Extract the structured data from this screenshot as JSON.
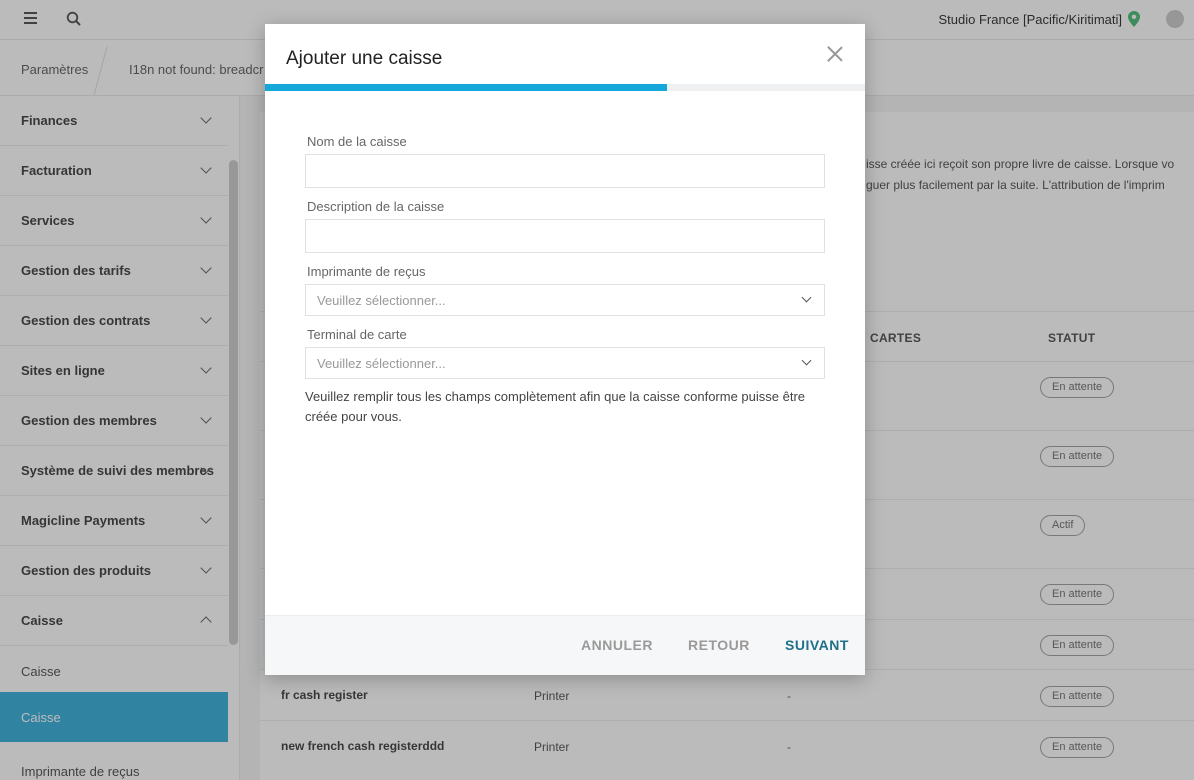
{
  "topbar": {
    "studio": "Studio France [Pacific/Kiritimati]",
    "menu_icon": "hamburger-icon",
    "search_icon": "search-icon",
    "location_icon": "map-pin-icon",
    "pin_color": "#3fb86f"
  },
  "breadcrumb": {
    "items": [
      "Paramètres",
      "I18n not found: breadcr"
    ]
  },
  "sidebar": {
    "items": [
      {
        "label": "Finances"
      },
      {
        "label": "Facturation"
      },
      {
        "label": "Services"
      },
      {
        "label": "Gestion des tarifs"
      },
      {
        "label": "Gestion des contrats"
      },
      {
        "label": "Sites en ligne"
      },
      {
        "label": "Gestion des membres"
      },
      {
        "label": "Système de suivi des membres"
      },
      {
        "label": "Magicline Payments"
      },
      {
        "label": "Gestion des produits"
      },
      {
        "label": "Caisse"
      }
    ],
    "subitems": [
      {
        "label": "Caisse"
      },
      {
        "label": "Caisse"
      },
      {
        "label": "Imprimante de reçus"
      }
    ],
    "active_color": "#2ba9d9"
  },
  "main": {
    "intro_line1": "isse créée ici reçoit son propre livre de caisse. Lorsque vo",
    "intro_line2": "guer plus facilement par la suite. L'attribution de l'imprim",
    "columns": {
      "cartes": "CARTES",
      "statut": "STATUT"
    },
    "status_badges": [
      "En attente",
      "En attente",
      "Actif",
      "En attente",
      "En attente"
    ],
    "rows": [
      {
        "name": "fr cash register",
        "printer": "Printer",
        "terminal": "-",
        "status": "En attente"
      },
      {
        "name": "new french cash registerddd",
        "printer": "Printer",
        "terminal": "-",
        "status": "En attente"
      }
    ]
  },
  "modal": {
    "title": "Ajouter une caisse",
    "progress": 0.67,
    "progress_color": "#15a6da",
    "fields": {
      "name_label": "Nom de la caisse",
      "name_value": "",
      "description_label": "Description de la caisse",
      "description_value": "",
      "printer_label": "Imprimante de reçus",
      "printer_placeholder": "Veuillez sélectionner...",
      "terminal_label": "Terminal de carte",
      "terminal_placeholder": "Veuillez sélectionner..."
    },
    "hint": "Veuillez remplir tous les champs complètement afin que la caisse conforme puisse être créée pour vous.",
    "footer": {
      "cancel": "ANNULER",
      "back": "RETOUR",
      "next": "SUIVANT",
      "next_color": "#1f6f8b"
    }
  }
}
